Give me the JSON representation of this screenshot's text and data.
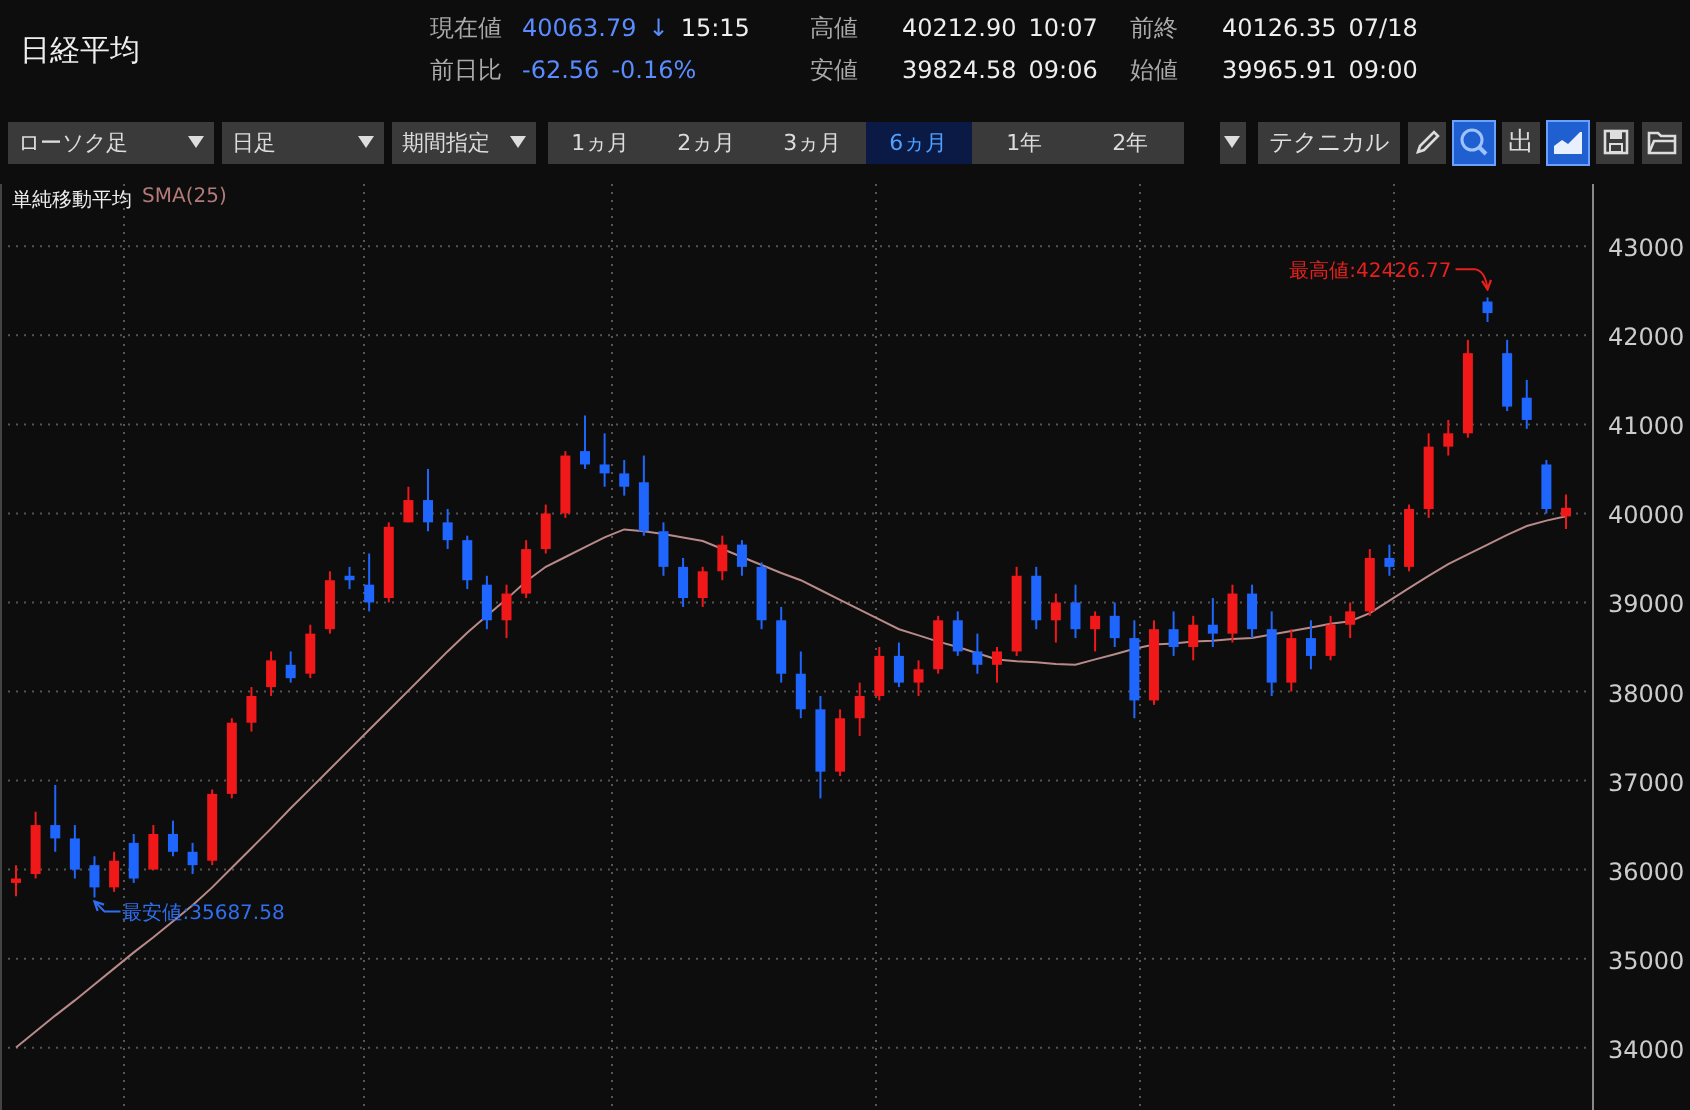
{
  "title": "日経平均",
  "quote_rows": [
    [
      {
        "label": "現在値",
        "values": [
          {
            "text": "40063.79",
            "color": "#5b8cff"
          },
          {
            "text": "↓",
            "color": "#5b8cff"
          },
          {
            "text": "15:15",
            "color": "#eeeeee"
          }
        ]
      },
      {
        "label": "高値",
        "values": [
          {
            "text": "40212.90",
            "color": "#eeeeee"
          },
          {
            "text": "10:07",
            "color": "#eeeeee"
          }
        ]
      },
      {
        "label": "前終",
        "values": [
          {
            "text": "40126.35",
            "color": "#eeeeee"
          },
          {
            "text": "07/18",
            "color": "#eeeeee"
          }
        ]
      }
    ],
    [
      {
        "label": "前日比",
        "values": [
          {
            "text": "-62.56",
            "color": "#5b8cff"
          },
          {
            "text": "-0.16%",
            "color": "#5b8cff"
          }
        ]
      },
      {
        "label": "安値",
        "values": [
          {
            "text": "39824.58",
            "color": "#eeeeee"
          },
          {
            "text": "09:06",
            "color": "#eeeeee"
          }
        ]
      },
      {
        "label": "始値",
        "values": [
          {
            "text": "39965.91",
            "color": "#eeeeee"
          },
          {
            "text": "09:00",
            "color": "#eeeeee"
          }
        ]
      }
    ]
  ],
  "toolbar": {
    "dropdowns": [
      "ローソク足",
      "日足",
      "期間指定"
    ],
    "periods": [
      {
        "label": "1ヵ月",
        "selected": false
      },
      {
        "label": "2ヵ月",
        "selected": false
      },
      {
        "label": "3ヵ月",
        "selected": false
      },
      {
        "label": "6ヵ月",
        "selected": true
      },
      {
        "label": "1年",
        "selected": false
      },
      {
        "label": "2年",
        "selected": false
      }
    ],
    "technical": "テクニカル",
    "tools": [
      {
        "kind": "pencil",
        "selected": false
      },
      {
        "kind": "zoom",
        "selected": true
      },
      {
        "kind": "text",
        "label": "出",
        "selected": false
      },
      {
        "kind": "area",
        "selected": true
      },
      {
        "kind": "save",
        "selected": false
      },
      {
        "kind": "folder",
        "selected": false
      }
    ]
  },
  "chart": {
    "legend": {
      "name": "単純移動平均"
    },
    "chart_data": {
      "type": "candlestick",
      "grid": true,
      "ylim": [
        33300,
        43700
      ],
      "yticks": [
        34000,
        35000,
        36000,
        37000,
        38000,
        39000,
        40000,
        41000,
        42000,
        43000
      ],
      "series": [
        {
          "name": "SMA(25)",
          "type": "line",
          "color": "#b88a8a",
          "values": [
            34000,
            34180,
            34360,
            34530,
            34710,
            34890,
            35070,
            35240,
            35420,
            35600,
            35800,
            36020,
            36240,
            36460,
            36690,
            36910,
            37130,
            37350,
            37570,
            37790,
            38010,
            38230,
            38450,
            38660,
            38850,
            39040,
            39240,
            39400,
            39510,
            39620,
            39730,
            39820,
            39800,
            39770,
            39730,
            39690,
            39600,
            39510,
            39420,
            39330,
            39250,
            39140,
            39030,
            38920,
            38810,
            38700,
            38630,
            38560,
            38500,
            38430,
            38360,
            38340,
            38330,
            38310,
            38300,
            38360,
            38420,
            38480,
            38530,
            38540,
            38560,
            38570,
            38590,
            38600,
            38640,
            38680,
            38720,
            38760,
            38790,
            38880,
            39020,
            39160,
            39300,
            39430,
            39540,
            39650,
            39760,
            39860,
            39920,
            39970
          ]
        }
      ],
      "annotations": [
        "最高値:42426.77",
        "最安値:35687.58"
      ],
      "ohlc": [
        [
          35850,
          36050,
          35700,
          35900
        ],
        [
          35950,
          36650,
          35900,
          36500
        ],
        [
          36500,
          36950,
          36200,
          36350
        ],
        [
          36350,
          36500,
          35900,
          36000
        ],
        [
          36050,
          36150,
          35687.58,
          35800
        ],
        [
          35800,
          36200,
          35750,
          36100
        ],
        [
          36300,
          36400,
          35850,
          35900
        ],
        [
          36000,
          36500,
          36000,
          36400
        ],
        [
          36400,
          36550,
          36150,
          36200
        ],
        [
          36200,
          36300,
          35950,
          36050
        ],
        [
          36100,
          36900,
          36050,
          36850
        ],
        [
          36850,
          37700,
          36800,
          37650
        ],
        [
          37650,
          38050,
          37550,
          37950
        ],
        [
          38050,
          38450,
          37950,
          38350
        ],
        [
          38300,
          38450,
          38100,
          38150
        ],
        [
          38200,
          38750,
          38150,
          38650
        ],
        [
          38700,
          39350,
          38650,
          39250
        ],
        [
          39300,
          39400,
          39150,
          39250
        ],
        [
          39200,
          39550,
          38900,
          39000
        ],
        [
          39050,
          39900,
          39000,
          39850
        ],
        [
          39900,
          40300,
          39900,
          40150
        ],
        [
          40150,
          40500,
          39800,
          39900
        ],
        [
          39900,
          40050,
          39600,
          39700
        ],
        [
          39700,
          39750,
          39150,
          39250
        ],
        [
          39200,
          39300,
          38700,
          38800
        ],
        [
          38800,
          39200,
          38600,
          39100
        ],
        [
          39100,
          39700,
          39050,
          39600
        ],
        [
          39600,
          40100,
          39550,
          40000
        ],
        [
          40000,
          40700,
          39950,
          40650
        ],
        [
          40700,
          41100,
          40500,
          40550
        ],
        [
          40550,
          40900,
          40300,
          40450
        ],
        [
          40450,
          40600,
          40200,
          40300
        ],
        [
          40350,
          40650,
          39750,
          39800
        ],
        [
          39800,
          39900,
          39300,
          39400
        ],
        [
          39400,
          39500,
          38950,
          39050
        ],
        [
          39050,
          39400,
          38950,
          39350
        ],
        [
          39350,
          39750,
          39250,
          39650
        ],
        [
          39650,
          39700,
          39300,
          39400
        ],
        [
          39400,
          39450,
          38700,
          38800
        ],
        [
          38800,
          38950,
          38100,
          38200
        ],
        [
          38200,
          38450,
          37700,
          37800
        ],
        [
          37800,
          37950,
          36800,
          37100
        ],
        [
          37100,
          37800,
          37050,
          37700
        ],
        [
          37700,
          38100,
          37500,
          37950
        ],
        [
          37950,
          38500,
          37900,
          38400
        ],
        [
          38400,
          38550,
          38050,
          38100
        ],
        [
          38100,
          38350,
          37950,
          38250
        ],
        [
          38250,
          38850,
          38200,
          38800
        ],
        [
          38800,
          38900,
          38400,
          38450
        ],
        [
          38450,
          38650,
          38200,
          38300
        ],
        [
          38300,
          38500,
          38100,
          38450
        ],
        [
          38450,
          39400,
          38400,
          39300
        ],
        [
          39300,
          39400,
          38700,
          38800
        ],
        [
          38800,
          39100,
          38550,
          39000
        ],
        [
          39000,
          39200,
          38600,
          38700
        ],
        [
          38700,
          38900,
          38450,
          38850
        ],
        [
          38850,
          39000,
          38500,
          38600
        ],
        [
          38600,
          38800,
          37700,
          37900
        ],
        [
          37900,
          38800,
          37850,
          38700
        ],
        [
          38700,
          38900,
          38400,
          38500
        ],
        [
          38500,
          38850,
          38350,
          38750
        ],
        [
          38750,
          39050,
          38500,
          38650
        ],
        [
          38650,
          39200,
          38550,
          39100
        ],
        [
          39100,
          39200,
          38600,
          38700
        ],
        [
          38700,
          38900,
          37950,
          38100
        ],
        [
          38100,
          38700,
          38000,
          38600
        ],
        [
          38600,
          38800,
          38250,
          38400
        ],
        [
          38400,
          38850,
          38350,
          38750
        ],
        [
          38750,
          39000,
          38600,
          38900
        ],
        [
          38900,
          39600,
          38850,
          39500
        ],
        [
          39500,
          39650,
          39300,
          39400
        ],
        [
          39400,
          40100,
          39350,
          40050
        ],
        [
          40050,
          40900,
          39950,
          40750
        ],
        [
          40750,
          41050,
          40650,
          40900
        ],
        [
          40900,
          41950,
          40850,
          41800
        ],
        [
          42380,
          42426.77,
          42150,
          42250
        ],
        [
          41800,
          41950,
          41150,
          41200
        ],
        [
          41300,
          41500,
          40950,
          41050
        ],
        [
          40550,
          40600,
          40000,
          40050
        ],
        [
          39965.91,
          40212.9,
          39824.58,
          40063.79
        ]
      ]
    }
  }
}
